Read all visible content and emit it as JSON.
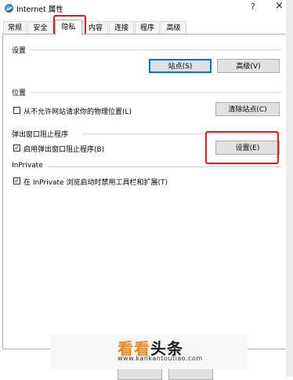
{
  "window": {
    "title": "Internet 属性",
    "close_label": "×",
    "help_label": "?"
  },
  "tabs": [
    {
      "label": "常规"
    },
    {
      "label": "安全"
    },
    {
      "label": "隐私"
    },
    {
      "label": "内容"
    },
    {
      "label": "连接"
    },
    {
      "label": "程序"
    },
    {
      "label": "高级"
    }
  ],
  "active_tab": "隐私",
  "sections": {
    "settings": {
      "title": "设置",
      "sites_button": "站点(S)",
      "advanced_button": "高级(V)"
    },
    "location": {
      "title": "位置",
      "checkbox_label": "从不允许网站请求你的物理位置(L)",
      "checked": false,
      "clear_button": "清除站点(C)"
    },
    "popup": {
      "title": "弹出窗口阻止程序",
      "checkbox_label": "启用弹出窗口阻止程序(B)",
      "checked": true,
      "settings_button": "设置(E)"
    },
    "inprivate": {
      "title": "InPrivate",
      "checkbox_label": "在 InPrivate 浏览启动时禁用工具栏和扩展(T)",
      "checked": true
    }
  },
  "watermark": {
    "big_part1": "看看",
    "big_part2": "头条",
    "url": "www.kankantoutiao.com"
  },
  "colors": {
    "highlight": "#e31b1b",
    "accent": "#0078d7",
    "watermark": "#f08a1c"
  }
}
